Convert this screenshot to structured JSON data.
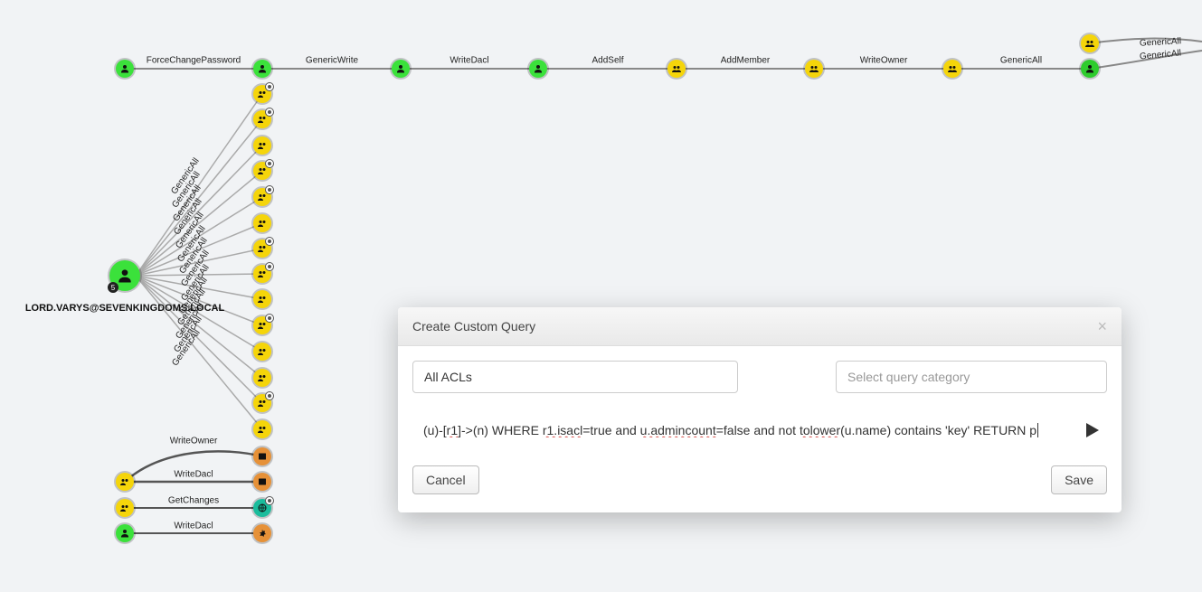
{
  "main_node": {
    "label": "LORD.VARYS@SEVENKINGDOMS.LOCAL",
    "badge": "5"
  },
  "top_edges": [
    {
      "label": "ForceChangePassword"
    },
    {
      "label": "GenericWrite"
    },
    {
      "label": "WriteDacl"
    },
    {
      "label": "AddSelf"
    },
    {
      "label": "AddMember"
    },
    {
      "label": "WriteOwner"
    },
    {
      "label": "GenericAll"
    }
  ],
  "right_pair_labels": {
    "top": "GenericAll",
    "bottom": "GenericAll"
  },
  "fan_label": "GenericAll",
  "bottom_edges": [
    {
      "label": "WriteOwner"
    },
    {
      "label": "WriteDacl"
    },
    {
      "label": "GetChanges"
    },
    {
      "label": "WriteDacl"
    }
  ],
  "dialog": {
    "title": "Create Custom Query",
    "name_value": "All ACLs",
    "category_placeholder": "Select query category",
    "query": {
      "p1": "(u)-[",
      "e1": "r1",
      "p2": "]->(n) WHERE ",
      "e2": "r1.isacl",
      "p3": "=true and ",
      "e3": "u.admincount",
      "p4": "=false and not ",
      "e4": "tolower",
      "p5": "(u.name) contains 'key' RETURN p"
    },
    "cancel": "Cancel",
    "save": "Save"
  }
}
